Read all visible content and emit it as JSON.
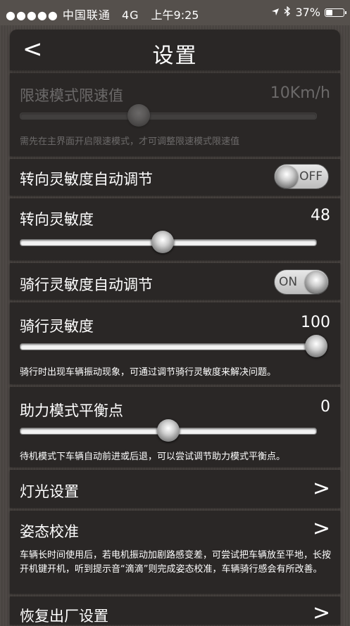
{
  "status_bar": {
    "signal": "●●●●● 中国联通",
    "network": "4G",
    "time": "上午9:25",
    "location_icon": "location-arrow-icon",
    "bluetooth_icon": "bluetooth-icon",
    "battery_text": "37%",
    "battery_level": 0.37
  },
  "nav": {
    "back": "<",
    "title": "设置"
  },
  "speed_limit": {
    "label": "限速模式限速值",
    "value": "10Km/h",
    "slider_level": 0.4,
    "hint": "需先在主界面开启限速模式，才可调整限速模式限速值"
  },
  "steering_auto": {
    "label": "转向灵敏度自动调节",
    "toggle_text": "OFF",
    "on": false
  },
  "steering_sensitivity": {
    "label": "转向灵敏度",
    "value": "48",
    "slider_level": 0.48
  },
  "riding_auto": {
    "label": "骑行灵敏度自动调节",
    "toggle_text": "ON",
    "on": true
  },
  "riding_sensitivity": {
    "label": "骑行灵敏度",
    "value": "100",
    "slider_level": 1.0,
    "hint": "骑行时出现车辆振动现象，可通过调节骑行灵敏度来解决问题。"
  },
  "balance_point": {
    "label": "助力模式平衡点",
    "value": "0",
    "slider_level": 0.5,
    "hint": "待机模式下车辆自动前进或后退，可以尝试调节助力模式平衡点。"
  },
  "lights": {
    "label": "灯光设置",
    "chevron": ">"
  },
  "calibration": {
    "label": "姿态校准",
    "chevron": ">",
    "hint": "车辆长时间使用后，若电机振动加剧路感变差，可尝试把车辆放至平地，长按开机键开机，听到提示音“滴滴”则完成姿态校准，车辆骑行感会有所改善。"
  },
  "factory_reset": {
    "label": "恢复出厂设置",
    "chevron": ">"
  }
}
